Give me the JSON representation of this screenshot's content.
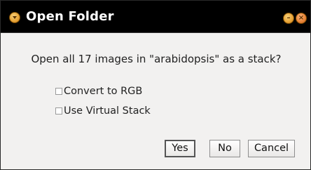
{
  "window": {
    "title": "Open Folder",
    "title_icon": "chevron-down-icon",
    "controls": {
      "minimize_icon": "minimize-icon",
      "close_icon": "close-icon"
    }
  },
  "dialog": {
    "message": "Open all 17 images in \"arabidopsis\" as a stack?",
    "options": [
      {
        "label": "Convert to RGB",
        "checked": false
      },
      {
        "label": "Use Virtual Stack",
        "checked": false
      }
    ],
    "buttons": {
      "yes": "Yes",
      "no": "No",
      "cancel": "Cancel"
    }
  },
  "colors": {
    "titlebar_bg": "#000000",
    "window_bg": "#f2f1f0",
    "accent": "#e8a63a"
  }
}
